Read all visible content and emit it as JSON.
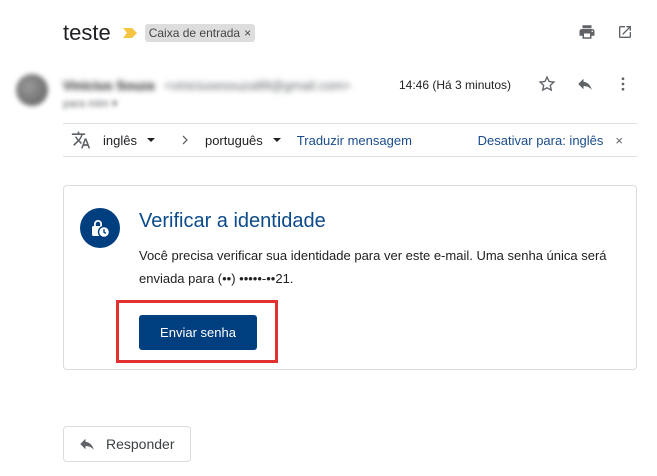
{
  "subject": "teste",
  "label": {
    "name": "Caixa de entrada",
    "remove": "×"
  },
  "sender": {
    "name": "Vinicius Souza",
    "email": "<viniciusesouza88@gmail.com>",
    "to": "para mim ▾"
  },
  "timestamp": "14:46 (Há 3 minutos)",
  "translate": {
    "from_lang": "inglês",
    "to_lang": "português",
    "translate_link": "Traduzir mensagem",
    "disable_link": "Desativar para: inglês",
    "close": "×"
  },
  "card": {
    "title": "Verificar a identidade",
    "body": "Você precisa verificar sua identidade para ver este e-mail. Uma senha única será enviada para (••) •••••-••21.",
    "button": "Enviar senha"
  },
  "reply_button": "Responder",
  "colors": {
    "accent": "#003f7f",
    "title": "#0b4a8b",
    "link": "#1a4c8c",
    "highlight": "#e03030"
  },
  "icons": [
    "label-importance-icon",
    "print-icon",
    "open-in-new-window-icon",
    "star-icon",
    "reply-icon",
    "more-vert-icon",
    "translate-icon",
    "chevron-right-icon",
    "locked-clock-icon"
  ]
}
